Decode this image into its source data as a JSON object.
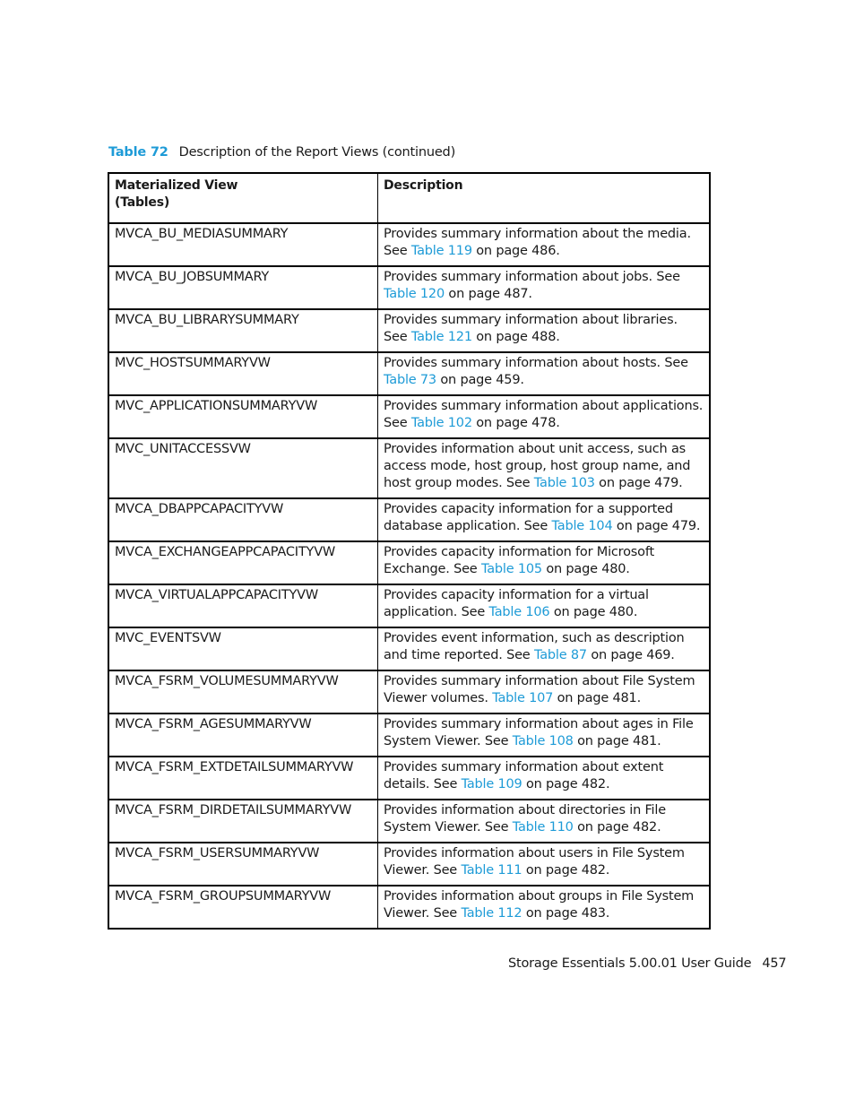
{
  "caption": {
    "label": "Table 72",
    "title": "Description of the Report Views (continued)"
  },
  "table": {
    "headers": {
      "col1_line1": "Materialized View",
      "col1_line2": "(Tables)",
      "col2": "Description"
    },
    "rows": [
      {
        "name": "MVCA_BU_MEDIASUMMARY",
        "pre": "Provides summary information about the media. See ",
        "link": "Table 119",
        "post": " on page 486."
      },
      {
        "name": "MVCA_BU_JOBSUMMARY",
        "pre": "Provides summary information about jobs. See ",
        "link": "Table 120",
        "post": " on page 487."
      },
      {
        "name": "MVCA_BU_LIBRARYSUMMARY",
        "pre": "Provides summary information about libraries. See ",
        "link": "Table 121",
        "post": " on page 488."
      },
      {
        "name": "MVC_HOSTSUMMARYVW",
        "pre": "Provides summary information about hosts. See ",
        "link": "Table 73",
        "post": " on page 459."
      },
      {
        "name": "MVC_APPLICATIONSUMMARYVW",
        "pre": "Provides summary information about applications. See ",
        "link": "Table 102",
        "post": " on page 478."
      },
      {
        "name": "MVC_UNITACCESSVW",
        "pre": "Provides information about unit access, such as access mode, host group, host group name, and host group modes. See ",
        "link": "Table 103",
        "post": " on page 479."
      },
      {
        "name": "MVCA_DBAPPCAPACITYVW",
        "pre": "Provides capacity information for a supported database application. See ",
        "link": "Table 104",
        "post": " on page 479."
      },
      {
        "name": "MVCA_EXCHANGEAPPCAPACITYVW",
        "pre": "Provides capacity information for Microsoft Exchange. See ",
        "link": "Table 105",
        "post": " on page 480."
      },
      {
        "name": "MVCA_VIRTUALAPPCAPACITYVW",
        "pre": "Provides capacity information for a virtual application. See ",
        "link": "Table 106",
        "post": " on page 480."
      },
      {
        "name": "MVC_EVENTSVW",
        "pre": "Provides event information, such as description and time reported. See ",
        "link": "Table 87",
        "post": " on page 469."
      },
      {
        "name": "MVCA_FSRM_VOLUMESUMMARYVW",
        "pre": "Provides summary information about File System Viewer volumes. ",
        "link": "Table 107",
        "post": " on page 481."
      },
      {
        "name": "MVCA_FSRM_AGESUMMARYVW",
        "pre": "Provides summary information about ages in File System Viewer. See ",
        "link": "Table 108",
        "post": " on page 481."
      },
      {
        "name": "MVCA_FSRM_EXTDETAILSUMMARYVW",
        "pre": "Provides summary information about extent details. See ",
        "link": "Table 109",
        "post": " on page 482."
      },
      {
        "name": "MVCA_FSRM_DIRDETAILSUMMARYVW",
        "pre": "Provides information about directories in File System Viewer. See ",
        "link": "Table 110",
        "post": " on page 482."
      },
      {
        "name": "MVCA_FSRM_USERSUMMARYVW",
        "pre": "Provides information about users in File System Viewer. See ",
        "link": "Table 111",
        "post": " on page 482."
      },
      {
        "name": "MVCA_FSRM_GROUPSUMMARYVW",
        "pre": "Provides information about groups in File System Viewer. See ",
        "link": "Table 112",
        "post": " on page 483."
      }
    ]
  },
  "footer": {
    "title": "Storage Essentials 5.00.01 User Guide",
    "page_number": "457"
  },
  "colors": {
    "link": "#1e9bd7",
    "text": "#1a1a1a",
    "border": "#000000"
  }
}
